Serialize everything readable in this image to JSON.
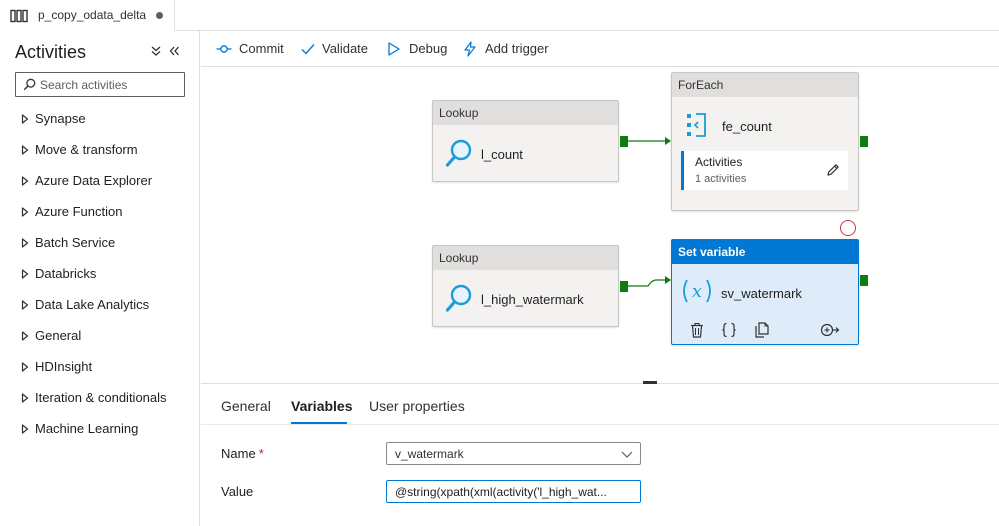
{
  "tab": {
    "title": "p_copy_odata_delta",
    "icon": "pipeline-icon"
  },
  "sidebar": {
    "title": "Activities",
    "search": {
      "placeholder": "Search activities",
      "value": ""
    },
    "categories": [
      {
        "label": "Synapse"
      },
      {
        "label": "Move & transform"
      },
      {
        "label": "Azure Data Explorer"
      },
      {
        "label": "Azure Function"
      },
      {
        "label": "Batch Service"
      },
      {
        "label": "Databricks"
      },
      {
        "label": "Data Lake Analytics"
      },
      {
        "label": "General"
      },
      {
        "label": "HDInsight"
      },
      {
        "label": "Iteration & conditionals"
      },
      {
        "label": "Machine Learning"
      }
    ]
  },
  "toolbar": {
    "commit": "Commit",
    "validate": "Validate",
    "debug": "Debug",
    "add_trigger": "Add trigger"
  },
  "canvas": {
    "activities": {
      "lookup1": {
        "type": "Lookup",
        "name": "l_count",
        "icon": "search-icon"
      },
      "foreach": {
        "type": "ForEach",
        "name": "fe_count",
        "icon": "foreach-icon",
        "inner_title": "Activities",
        "inner_count": "1 activities"
      },
      "lookup2": {
        "type": "Lookup",
        "name": "l_high_watermark",
        "icon": "search-icon"
      },
      "setvar": {
        "type": "Set variable",
        "name": "sv_watermark",
        "icon": "variable-icon",
        "selected": true
      }
    }
  },
  "properties": {
    "tabs": [
      "General",
      "Variables",
      "User properties"
    ],
    "active_tab": "Variables",
    "name_label": "Name",
    "name_required": "*",
    "name_value": "v_watermark",
    "value_label": "Value",
    "value_text": "@string(xpath(xml(activity('l_high_wat..."
  },
  "colors": {
    "accent": "#0078d4",
    "success": "#107c10",
    "error": "#d13438"
  }
}
